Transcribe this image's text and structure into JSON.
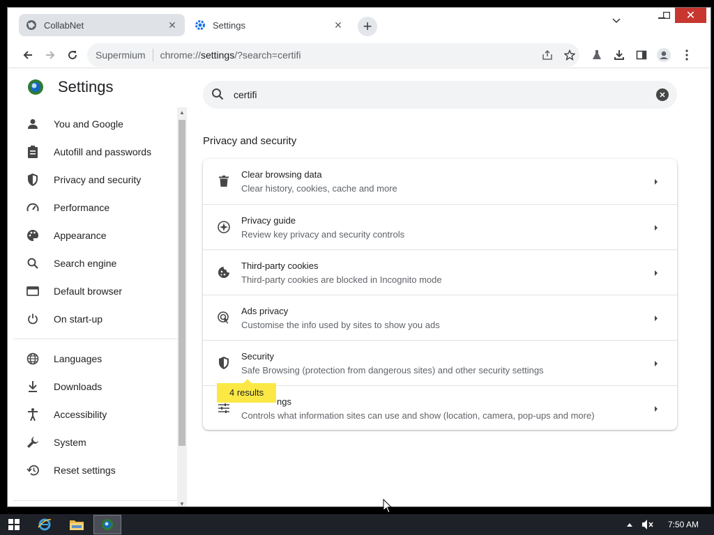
{
  "tabs": [
    {
      "title": "CollabNet",
      "icon": "globe-icon"
    },
    {
      "title": "Settings",
      "icon": "gear-icon"
    }
  ],
  "toolbar": {
    "omnibox_chip": "Supermium",
    "url_prefix": "chrome://",
    "url_host": "settings",
    "url_rest": "/?search=certifi"
  },
  "settings": {
    "title": "Settings",
    "nav": [
      {
        "label": "You and Google",
        "icon": "person-icon"
      },
      {
        "label": "Autofill and passwords",
        "icon": "clipboard-icon"
      },
      {
        "label": "Privacy and security",
        "icon": "shield-icon"
      },
      {
        "label": "Performance",
        "icon": "speedometer-icon"
      },
      {
        "label": "Appearance",
        "icon": "palette-icon"
      },
      {
        "label": "Search engine",
        "icon": "search-icon"
      },
      {
        "label": "Default browser",
        "icon": "browser-icon"
      },
      {
        "label": "On start-up",
        "icon": "power-icon"
      },
      {
        "label": "Languages",
        "icon": "globe-icon"
      },
      {
        "label": "Downloads",
        "icon": "download-icon"
      },
      {
        "label": "Accessibility",
        "icon": "accessibility-icon"
      },
      {
        "label": "System",
        "icon": "wrench-icon"
      },
      {
        "label": "Reset settings",
        "icon": "history-icon"
      }
    ],
    "search_value": "certifi",
    "section_title": "Privacy and security",
    "rows": [
      {
        "title": "Clear browsing data",
        "subtitle": "Clear history, cookies, cache and more",
        "icon": "trash-icon"
      },
      {
        "title": "Privacy guide",
        "subtitle": "Review key privacy and security controls",
        "icon": "compass-icon"
      },
      {
        "title": "Third-party cookies",
        "subtitle": "Third-party cookies are blocked in Incognito mode",
        "icon": "cookie-icon"
      },
      {
        "title": "Ads privacy",
        "subtitle": "Customise the info used by sites to show you ads",
        "icon": "ads-icon"
      },
      {
        "title": "Security",
        "subtitle": "Safe Browsing (protection from dangerous sites) and other security settings",
        "icon": "shield-icon"
      },
      {
        "title": "ngs",
        "subtitle": "Controls what information sites can use and show (location, camera, pop-ups and more)",
        "icon": "sliders-icon"
      }
    ],
    "results_bubble": "4 results"
  },
  "taskbar": {
    "clock": "7:50 AM"
  }
}
